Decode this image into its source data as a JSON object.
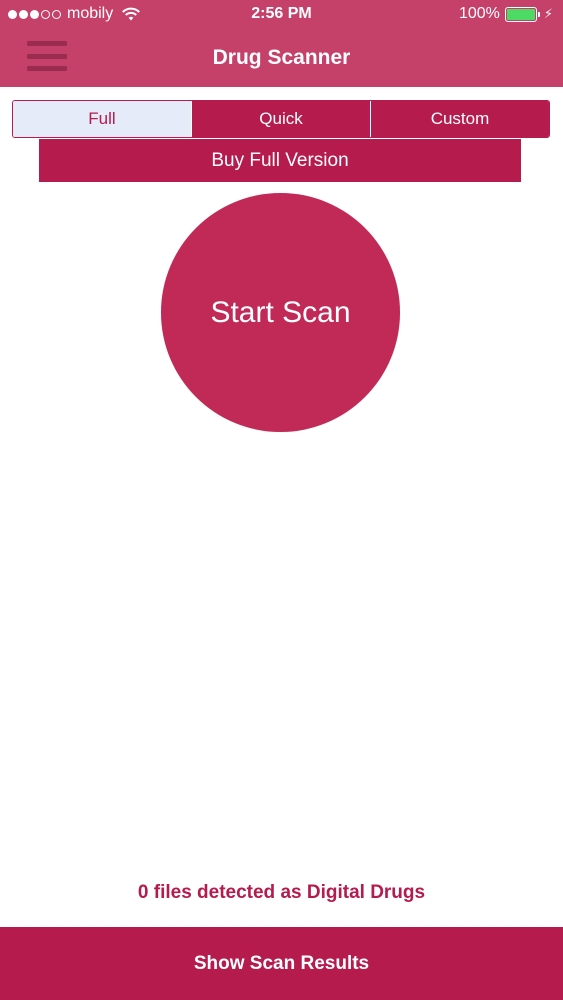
{
  "status_bar": {
    "carrier": "mobily",
    "signal_dots_filled": 3,
    "signal_dots_total": 5,
    "time": "2:56 PM",
    "battery_percent": "100%",
    "battery_level": 1.0,
    "battery_color": "#4cd964"
  },
  "nav": {
    "title": "Drug Scanner",
    "menu_icon": "hamburger-menu-icon"
  },
  "scan_modes": {
    "options": [
      "Full",
      "Quick",
      "Custom"
    ],
    "selected": "Full"
  },
  "buy_button": {
    "label": "Buy Full Version"
  },
  "start_button": {
    "label": "Start Scan"
  },
  "detected_text": "0 files detected as Digital Drugs",
  "results_button": {
    "label": "Show Scan Results"
  },
  "colors": {
    "header_bg": "#c5416a",
    "accent": "#b51b4d",
    "circle": "#c12a57",
    "selected_segment_bg": "#e6ebfa"
  }
}
